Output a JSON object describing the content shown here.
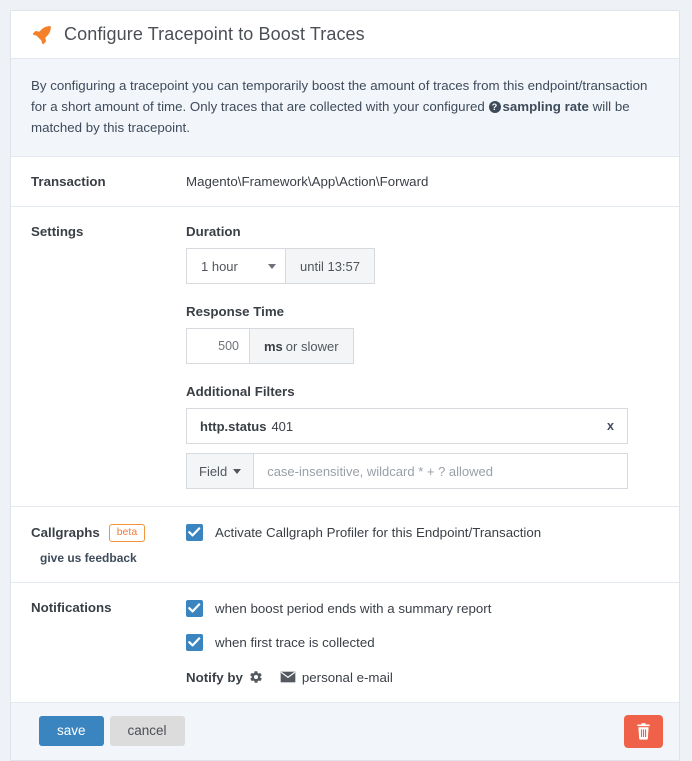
{
  "header": {
    "icon": "rocket-icon",
    "title": "Configure Tracepoint to Boost Traces"
  },
  "description": {
    "part1": "By configuring a tracepoint you can temporarily boost the amount of traces from this endpoint/transaction for a short amount of time. Only traces that are collected with your configured",
    "help_icon": "help-circle-icon",
    "link": "sampling rate",
    "part2": "will be matched by this tracepoint."
  },
  "transaction": {
    "label": "Transaction",
    "value": "Magento\\Framework\\App\\Action\\Forward"
  },
  "settings": {
    "label": "Settings",
    "duration": {
      "label": "Duration",
      "selected": "1 hour",
      "until": "until 13:57"
    },
    "response_time": {
      "label": "Response Time",
      "value": "500",
      "unit": "ms",
      "suffix": "or slower"
    },
    "additional_filters": {
      "label": "Additional Filters",
      "applied": [
        {
          "key": "http.status",
          "value": "401",
          "remove": "x"
        }
      ],
      "new_filter": {
        "field_button": "Field",
        "placeholder": "case-insensitive, wildcard * + ? allowed",
        "value": ""
      }
    }
  },
  "callgraphs": {
    "label": "Callgraphs",
    "badge": "beta",
    "feedback_link": "give us feedback",
    "checkbox": {
      "checked": true,
      "text": "Activate Callgraph Profiler for this Endpoint/Transaction"
    }
  },
  "notifications": {
    "label": "Notifications",
    "checkboxes": [
      {
        "checked": true,
        "text": "when boost period ends with a summary report"
      },
      {
        "checked": true,
        "text": "when first trace is collected"
      }
    ],
    "notify_by": {
      "label": "Notify by",
      "gear_icon": "gear-icon",
      "mail_icon": "envelope-icon",
      "target": "personal e-mail"
    }
  },
  "footer": {
    "save": "save",
    "cancel": "cancel",
    "delete_icon": "trash-icon"
  },
  "colors": {
    "accent_blue": "#3a85c0",
    "orange": "#ef7c3c",
    "danger_red": "#f0614a",
    "page_bg": "#eef1f6",
    "section_bg": "#f2f5f9"
  }
}
